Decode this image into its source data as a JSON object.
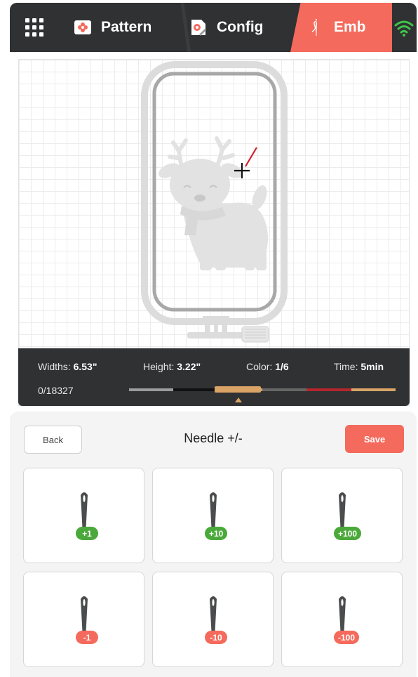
{
  "tabs": [
    {
      "id": "pattern",
      "label": "Pattern",
      "icon": "flower-card-icon"
    },
    {
      "id": "config",
      "label": "Config",
      "icon": "settings-card-icon"
    },
    {
      "id": "emb",
      "label": "Emb",
      "icon": "needle-thread-icon",
      "active": true
    }
  ],
  "colors": {
    "topbar": "#2f3133",
    "accent": "#f46a5c",
    "plus_badge": "#4aa93a",
    "minus_badge": "#f46a5c",
    "wifi": "#3fc449"
  },
  "info": {
    "width_label": "Widths: ",
    "width_value": "6.53\"",
    "height_label": "Height: ",
    "height_value": "3.22\"",
    "color_label": "Color: ",
    "color_value": "1/6",
    "time_label": "Time: ",
    "time_value": "5min",
    "stitch_count": "0/18327"
  },
  "thread_colors": [
    "#9c9c9c",
    "#111111",
    "#d9a466",
    "#666666",
    "#b3262c",
    "#d9a466"
  ],
  "panel": {
    "back_label": "Back",
    "title": "Needle +/-",
    "save_label": "Save"
  },
  "needle_buttons": [
    {
      "label": "+1",
      "type": "plus"
    },
    {
      "label": "+10",
      "type": "plus"
    },
    {
      "label": "+100",
      "type": "plus"
    },
    {
      "label": "-1",
      "type": "minus"
    },
    {
      "label": "-10",
      "type": "minus"
    },
    {
      "label": "-100",
      "type": "minus"
    }
  ]
}
